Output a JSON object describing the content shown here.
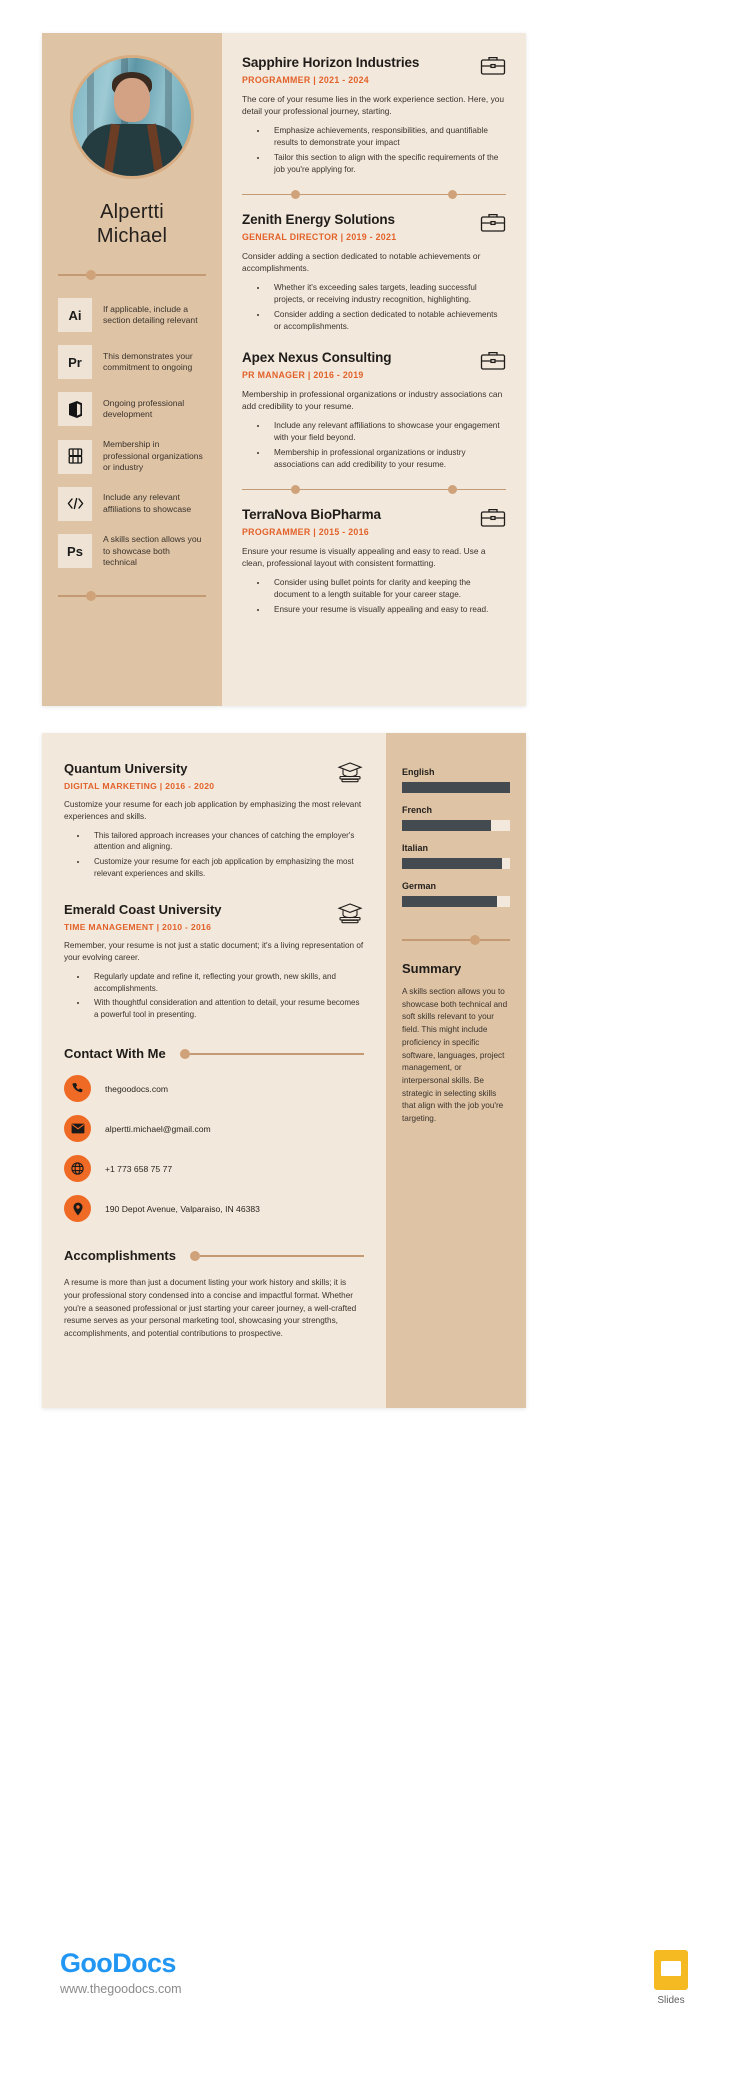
{
  "profile": {
    "first_name": "Alpertti",
    "last_name": "Michael",
    "photo_alt": "profile-photo"
  },
  "skills": [
    {
      "icon": "adobe-illustrator-icon",
      "badge": "Ai",
      "text": "If applicable, include a section detailing relevant"
    },
    {
      "icon": "adobe-premiere-icon",
      "badge": "Pr",
      "text": "This demonstrates your commitment to ongoing"
    },
    {
      "icon": "microsoft-office-icon",
      "badge": "",
      "text": "Ongoing professional development"
    },
    {
      "icon": "figma-icon",
      "badge": "",
      "text": "Membership in professional organizations or industry"
    },
    {
      "icon": "code-brackets-icon",
      "badge": "",
      "text": "Include any relevant affiliations to showcase"
    },
    {
      "icon": "adobe-photoshop-icon",
      "badge": "Ps",
      "text": "A skills section allows you to showcase both technical"
    }
  ],
  "experience": [
    {
      "company": "Sapphire Horizon Industries",
      "meta": "PROGRAMMER | 2021 - 2024",
      "description": "The core of your resume lies in the work experience section. Here, you detail your professional journey, starting.",
      "bullets": [
        "Emphasize achievements, responsibilities, and quantifiable results to demonstrate your impact",
        "Tailor this section to align with the specific requirements of the job you're applying for."
      ]
    },
    {
      "company": "Zenith Energy Solutions",
      "meta": "GENERAL DIRECTOR | 2019 - 2021",
      "description": "Consider adding a section dedicated to notable achievements or accomplishments.",
      "bullets": [
        "Whether it's exceeding sales targets, leading successful projects, or receiving industry recognition, highlighting.",
        "Consider adding a section dedicated to notable achievements or accomplishments."
      ]
    },
    {
      "company": "Apex Nexus Consulting",
      "meta": "PR MANAGER | 2016 - 2019",
      "description": "Membership in professional organizations or industry associations can add credibility to your resume.",
      "bullets": [
        "Include any relevant affiliations to showcase your engagement with your field beyond.",
        "Membership in professional organizations or industry associations can add credibility to your resume."
      ]
    },
    {
      "company": "TerraNova BioPharma",
      "meta": "PROGRAMMER | 2015 - 2016",
      "description": "Ensure your resume is visually appealing and easy to read. Use a clean, professional layout with consistent formatting.",
      "bullets": [
        "Consider using bullet points for clarity and keeping the document to a length suitable for your career stage.",
        "Ensure your resume is visually appealing and easy to read."
      ]
    }
  ],
  "education": [
    {
      "school": "Quantum University",
      "meta": "DIGITAL MARKETING | 2016 - 2020",
      "description": "Customize your resume for each job application by emphasizing the most relevant experiences and skills.",
      "bullets": [
        "This tailored approach increases your chances of catching the employer's attention and aligning.",
        "Customize your resume for each job application by emphasizing the most relevant experiences and skills."
      ]
    },
    {
      "school": "Emerald Coast University",
      "meta": "TIME MANAGEMENT | 2010 - 2016",
      "description": "Remember, your resume is not just a static document; it's a living representation of your evolving career.",
      "bullets": [
        "Regularly update and refine it, reflecting your growth, new skills, and accomplishments.",
        "With thoughtful consideration and attention to detail, your resume becomes a powerful tool in presenting."
      ]
    }
  ],
  "contact": {
    "title": "Contact With Me",
    "items": [
      {
        "icon": "phone-icon",
        "value": "thegoodocs.com"
      },
      {
        "icon": "envelope-icon",
        "value": "alpertti.michael@gmail.com"
      },
      {
        "icon": "globe-icon",
        "value": "+1 773 658 75 77"
      },
      {
        "icon": "location-pin-icon",
        "value": "190 Depot Avenue, Valparaiso, IN 46383"
      }
    ]
  },
  "accomplishments": {
    "title": "Accomplishments",
    "body": "A resume is more than just a document listing your work history and skills; it is your professional story condensed into a concise and impactful format. Whether you're a seasoned professional or just starting your career journey, a well-crafted resume serves as your personal marketing tool, showcasing your strengths, accomplishments, and potential contributions to prospective."
  },
  "languages": {
    "items": [
      {
        "name": "English",
        "level": 100
      },
      {
        "name": "French",
        "level": 82
      },
      {
        "name": "Italian",
        "level": 93
      },
      {
        "name": "German",
        "level": 88
      }
    ]
  },
  "summary": {
    "title": "Summary",
    "body": "A skills section allows you to showcase both technical and soft skills relevant to your field. This might include proficiency in specific software, languages, project management, or interpersonal skills. Be strategic in selecting skills that align with the job you're targeting."
  },
  "footer": {
    "brand_part1": "Goo",
    "brand_part2": "Docs",
    "url": "www.thegoodocs.com",
    "slides_label": "Slides"
  },
  "colors": {
    "accent_orange": "#e2622a",
    "icon_orange": "#ef6a24",
    "tan": "#dec3a5",
    "cream": "#f2e8dc",
    "dark_bar": "#434b50",
    "rule": "#c49a74",
    "brand_blue": "#2196f3",
    "slides_yellow": "#f5ba21"
  }
}
